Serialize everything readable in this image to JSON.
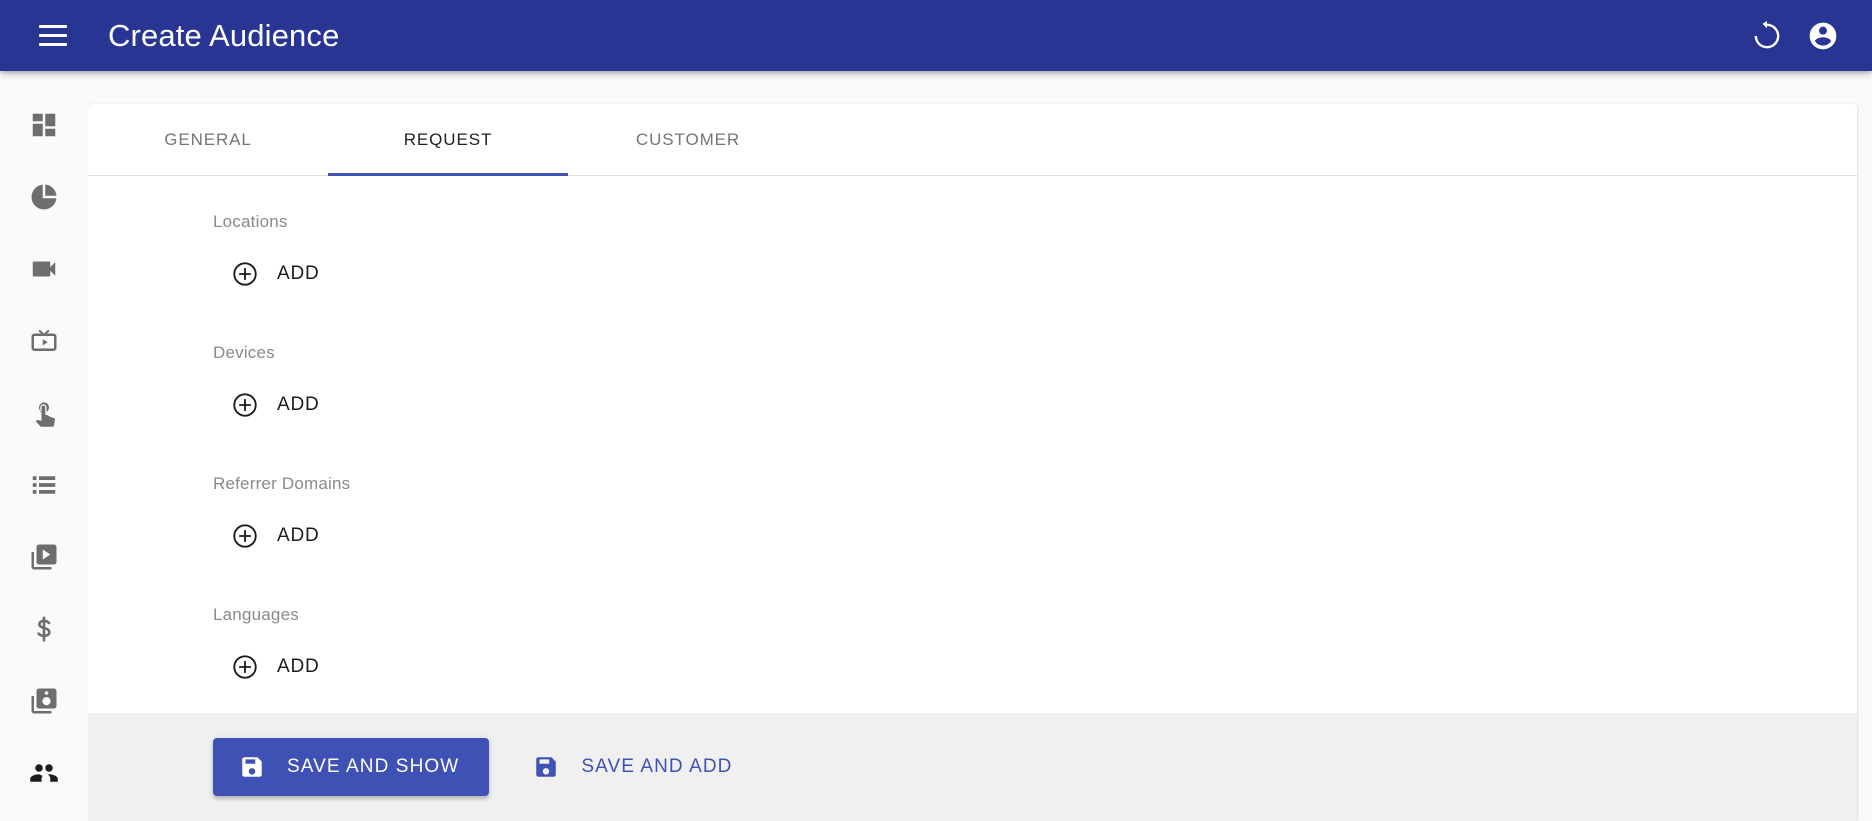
{
  "toolbar": {
    "menu_icon": "hamburger-menu-icon",
    "title": "Create Audience",
    "refresh_icon": "refresh-icon",
    "account_icon": "account-circle-icon",
    "background_color": "#283593"
  },
  "sidebar": {
    "items": [
      {
        "icon": "dashboard-icon",
        "active": false
      },
      {
        "icon": "pie-chart-icon",
        "active": false
      },
      {
        "icon": "videocam-icon",
        "active": false
      },
      {
        "icon": "live-tv-icon",
        "active": false
      },
      {
        "icon": "touch-app-icon",
        "active": false
      },
      {
        "icon": "list-icon",
        "active": false
      },
      {
        "icon": "video-library-icon",
        "active": false
      },
      {
        "icon": "dollar-icon",
        "active": false
      },
      {
        "icon": "audio-library-icon",
        "active": false
      },
      {
        "icon": "people-icon",
        "active": true
      }
    ]
  },
  "tabs": [
    {
      "label": "GENERAL",
      "active": false
    },
    {
      "label": "REQUEST",
      "active": true
    },
    {
      "label": "CUSTOMER",
      "active": false
    }
  ],
  "accent_color": "#3f51b5",
  "form": {
    "sections": [
      {
        "label": "Locations",
        "add_label": "ADD",
        "add_icon": "add-circle-outline-icon"
      },
      {
        "label": "Devices",
        "add_label": "ADD",
        "add_icon": "add-circle-outline-icon"
      },
      {
        "label": "Referrer Domains",
        "add_label": "ADD",
        "add_icon": "add-circle-outline-icon"
      },
      {
        "label": "Languages",
        "add_label": "ADD",
        "add_icon": "add-circle-outline-icon"
      }
    ]
  },
  "footer": {
    "primary": {
      "label": "SAVE AND SHOW",
      "icon": "save-icon"
    },
    "secondary": {
      "label": "SAVE AND ADD",
      "icon": "save-icon"
    }
  }
}
